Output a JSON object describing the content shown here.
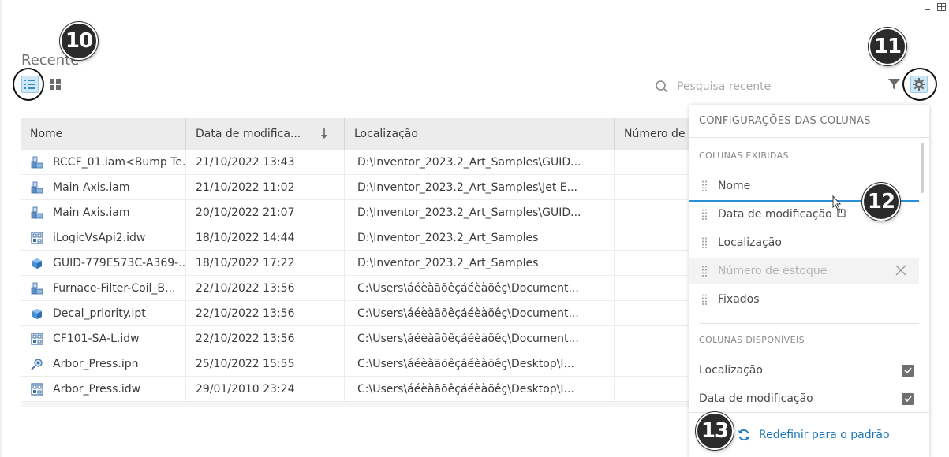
{
  "page": {
    "title": "Recente"
  },
  "toolbar": {
    "search_placeholder": "Pesquisa recente"
  },
  "callouts": {
    "c10": "10",
    "c11": "11",
    "c12": "12",
    "c13": "13"
  },
  "table": {
    "headers": [
      "Nome",
      "Data de modifica...",
      "Localização",
      "Número de e"
    ],
    "rows": [
      {
        "icon": "assembly-icon",
        "name": "RCCF_01.iam<Bump Te...",
        "date": "21/10/2022 13:43",
        "location": "D:\\Inventor_2023.2_Art_Samples\\GUID..."
      },
      {
        "icon": "assembly-icon",
        "name": "Main Axis.iam",
        "date": "21/10/2022 11:02",
        "location": "D:\\Inventor_2023.2_Art_Samples\\Jet E..."
      },
      {
        "icon": "assembly-icon",
        "name": "Main Axis.iam",
        "date": "20/10/2022 21:07",
        "location": "D:\\Inventor_2023.2_Art_Samples\\GUID..."
      },
      {
        "icon": "drawing-icon",
        "name": "iLogicVsApi2.idw",
        "date": "18/10/2022 14:44",
        "location": "D:\\Inventor_2023.2_Art_Samples"
      },
      {
        "icon": "part-icon",
        "name": "GUID-779E573C-A369-...",
        "date": "18/10/2022 17:22",
        "location": "D:\\Inventor_2023.2_Art_Samples"
      },
      {
        "icon": "assembly-icon",
        "name": "Furnace-Filter-Coil_B...",
        "date": "22/10/2022 13:56",
        "location": "C:\\Users\\áéèàãõêçáéèàõêç\\Document..."
      },
      {
        "icon": "part-icon",
        "name": "Decal_priority.ipt",
        "date": "22/10/2022 13:56",
        "location": "C:\\Users\\áéèàãõêçáéèàõêç\\Document..."
      },
      {
        "icon": "drawing-icon",
        "name": "CF101-SA-L.idw",
        "date": "22/10/2022 13:56",
        "location": "C:\\Users\\áéèàãõêçáéèàõêç\\Document..."
      },
      {
        "icon": "presentation-icon",
        "name": "Arbor_Press.ipn",
        "date": "25/10/2022 15:55",
        "location": "C:\\Users\\áéèàãõêçáéèàõêç\\Desktop\\I..."
      },
      {
        "icon": "drawing-icon",
        "name": "Arbor_Press.idw",
        "date": "29/01/2010 23:24",
        "location": "C:\\Users\\áéèàãõêçáéèàõêç\\Desktop\\I..."
      }
    ]
  },
  "column_panel": {
    "title": "CONFIGURAÇÕES DAS COLUNAS",
    "displayed_label": "COLUNAS EXIBIDAS",
    "displayed": [
      {
        "label": "Nome"
      },
      {
        "label": "Data de modificação"
      },
      {
        "label": "Localização"
      },
      {
        "label": "Número de estoque",
        "disabled": true
      },
      {
        "label": "Fixados"
      }
    ],
    "available_label": "COLUNAS DISPONÍVEIS",
    "available": [
      {
        "label": "Localização",
        "checked": true
      },
      {
        "label": "Data de modificação",
        "checked": true
      }
    ],
    "reset_label": "Redefinir para o padrão"
  },
  "colors": {
    "accent": "#1a74b8",
    "selected_bg": "#cfe8f7",
    "drop_line": "#2a91d8",
    "header_bg": "#ececec"
  }
}
